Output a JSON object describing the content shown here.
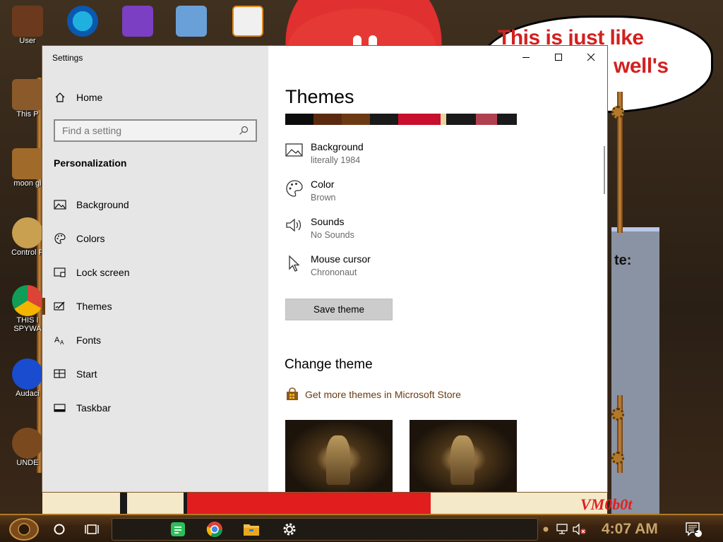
{
  "desktop": {
    "icons": [
      {
        "label": "User",
        "color": "#6b3a1e"
      },
      {
        "label": "This P",
        "color": "#8b5a2b"
      },
      {
        "label": "moon gi",
        "color": "#a06a2a"
      },
      {
        "label": "Control P",
        "color": "#c8a050"
      },
      {
        "label": "THIS I",
        "label2": "SPYWA",
        "color": "#db4437"
      },
      {
        "label": "Audaci",
        "color": "#1a4ccf"
      },
      {
        "label": "UNDE",
        "color": "#7a4a1e"
      }
    ],
    "top_icons": [
      {
        "label": "",
        "color": "#0a7ad4"
      },
      {
        "label": "",
        "color": "#7b3fc4"
      },
      {
        "label": "",
        "color": "#6aa0d8"
      },
      {
        "label": "",
        "color": "#f0f0f0"
      }
    ],
    "bubble_line1": "This is just like",
    "bubble_line2": "well's",
    "gray_panel_text": "te:",
    "vm_text": "VM0b0t"
  },
  "settings": {
    "window_title": "Settings",
    "controls": {
      "minimize": "—",
      "maximize": "☐",
      "close": "✕"
    },
    "sidebar": {
      "home_label": "Home",
      "search_placeholder": "Find a setting",
      "section_title": "Personalization",
      "items": [
        {
          "label": "Background",
          "icon": "image-icon"
        },
        {
          "label": "Colors",
          "icon": "palette-icon"
        },
        {
          "label": "Lock screen",
          "icon": "lock-screen-icon"
        },
        {
          "label": "Themes",
          "icon": "themes-icon",
          "selected": true
        },
        {
          "label": "Fonts",
          "icon": "fonts-icon"
        },
        {
          "label": "Start",
          "icon": "start-icon"
        },
        {
          "label": "Taskbar",
          "icon": "taskbar-icon"
        }
      ]
    },
    "main": {
      "heading": "Themes",
      "properties": [
        {
          "label": "Background",
          "value": "literally 1984",
          "icon": "image-icon"
        },
        {
          "label": "Color",
          "value": "Brown",
          "icon": "palette-icon"
        },
        {
          "label": "Sounds",
          "value": "No Sounds",
          "icon": "speaker-icon"
        },
        {
          "label": "Mouse cursor",
          "value": "Chrononaut",
          "icon": "cursor-icon"
        }
      ],
      "save_button": "Save theme",
      "change_theme_heading": "Change theme",
      "store_link": "Get more themes in Microsoft Store"
    }
  },
  "taskbar": {
    "clock": "4:07 AM",
    "notification_count": "2",
    "accent": "#c8a46a"
  }
}
